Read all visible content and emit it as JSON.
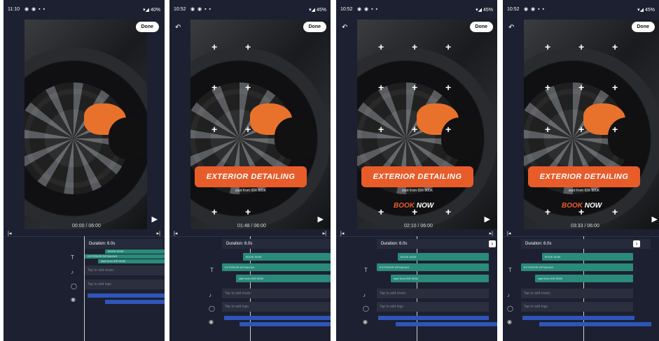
{
  "panels": [
    {
      "status_time": "11:10",
      "status_right": "40%",
      "timecode_current": "00:00",
      "timecode_total": "06:00",
      "duration_label": "Duration: 6.0s",
      "tracks": {
        "text1": "BOOK NOW",
        "text2": "EXTERIOR DETAILING",
        "text3": "start from IDR 500K",
        "music": "Tap to add music",
        "logo": "Tap to add logo"
      }
    },
    {
      "status_time": "10:52",
      "status_right": "45%",
      "done_label": "Done",
      "timecode_current": "01:48",
      "timecode_total": "06:00",
      "duration_label": "Duration: 6.0s",
      "banner_text": "EXTERIOR DETAILING",
      "subline": "start from IDR 500K",
      "tracks": {
        "text1": "BOOK NOW",
        "text2": "EXTERIOR DETAILING",
        "text3": "start from IDR 500K",
        "music": "Tap to add music",
        "logo": "Tap to add logo"
      }
    },
    {
      "status_time": "10:52",
      "status_right": "45%",
      "done_label": "Done",
      "timecode_current": "02:10",
      "timecode_total": "06:00",
      "duration_label": "Duration: 6.0s",
      "banner_text": "EXTERIOR DETAILING",
      "subline": "start from IDR 500K",
      "book_word": "BOOK",
      "now_word": "NOW",
      "tracks": {
        "text1": "BOOK NOW",
        "text2": "EXTERIOR DETAILING",
        "text3": "start from IDR 500K",
        "music": "Tap to add music",
        "logo": "Tap to add logo"
      }
    },
    {
      "status_time": "10:52",
      "status_right": "45%",
      "done_label": "Done",
      "timecode_current": "03:33",
      "timecode_total": "06:00",
      "duration_label": "Duration: 6.0s",
      "banner_text": "EXTERIOR DETAILING",
      "subline": "start from IDR 500K",
      "book_word": "BOOK",
      "now_word": "NOW",
      "tracks": {
        "text1": "BOOK NOW",
        "text2": "EXTERIOR DETAILING",
        "text3": "start from IDR 500K",
        "music": "Tap to add music",
        "logo": "Tap to add logo"
      }
    }
  ],
  "done_label_panel1": "Done",
  "colors": {
    "accent": "#e85c2a",
    "teal": "#2b8a7a",
    "blue": "#2f55b8",
    "background": "#1c2030"
  },
  "icons": [
    "back-arrow-icon",
    "play-icon",
    "skip-start-icon",
    "skip-end-icon",
    "text-track-icon",
    "music-track-icon",
    "logo-track-icon",
    "video-track-icon",
    "chevron-right-icon"
  ]
}
